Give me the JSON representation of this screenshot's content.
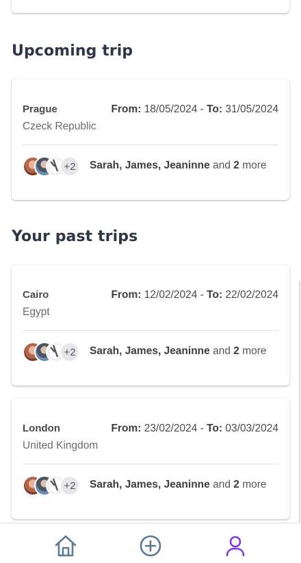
{
  "upcoming": {
    "title": "Upcoming trip",
    "trip": {
      "city": "Prague",
      "country": "Czeck Republic",
      "from_label": "From:",
      "from_date": "18/05/2024",
      "separator": "-",
      "to_label": "To:",
      "to_date": "31/05/2024",
      "extra_count": "+2",
      "people_names": "Sarah, James, Jeaninne",
      "and_text": "and",
      "more_count": "2",
      "more_text": "more"
    }
  },
  "past": {
    "title": "Your past trips",
    "trips": [
      {
        "city": "Cairo",
        "country": "Egypt",
        "from_label": "From:",
        "from_date": "12/02/2024",
        "separator": "-",
        "to_label": "To:",
        "to_date": "22/02/2024",
        "extra_count": "+2",
        "people_names": "Sarah, James, Jeaninne",
        "and_text": "and",
        "more_count": "2",
        "more_text": "more"
      },
      {
        "city": "London",
        "country": "United Kingdom",
        "from_label": "From:",
        "from_date": "23/02/2024",
        "separator": "-",
        "to_label": "To:",
        "to_date": "03/03/2024",
        "extra_count": "+2",
        "people_names": "Sarah, James, Jeaninne",
        "and_text": "and",
        "more_count": "2",
        "more_text": "more"
      }
    ]
  },
  "nav": {
    "items": [
      {
        "icon": "home-icon",
        "color": "#5b7b95"
      },
      {
        "icon": "plus-circle-icon",
        "color": "#5b7b95"
      },
      {
        "icon": "user-icon",
        "color": "#7c3aed",
        "active": true
      }
    ]
  }
}
